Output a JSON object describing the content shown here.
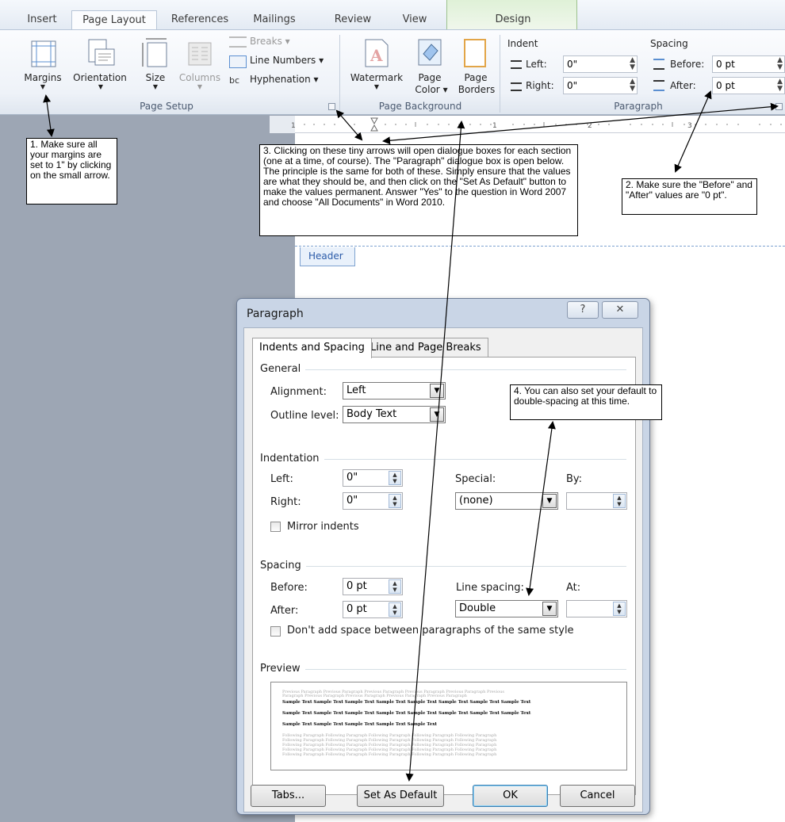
{
  "ribbon_tabs": [
    {
      "label": "Insert"
    },
    {
      "label": "Page Layout"
    },
    {
      "label": "References"
    },
    {
      "label": "Mailings"
    },
    {
      "label": "Review"
    },
    {
      "label": "View"
    },
    {
      "label": "Design"
    }
  ],
  "page_setup": {
    "margins": "Margins",
    "orientation": "Orientation",
    "size": "Size",
    "columns": "Columns",
    "breaks": "Breaks",
    "line_numbers": "Line Numbers",
    "hyphenation": "Hyphenation",
    "group": "Page Setup"
  },
  "page_background": {
    "watermark": "Watermark",
    "page_color_1": "Page",
    "page_color_2": "Color",
    "page_borders_1": "Page",
    "page_borders_2": "Borders",
    "group": "Page Background"
  },
  "paragraph_group": {
    "indent_title": "Indent",
    "left_label": "Left:",
    "left_value": "0\"",
    "right_label": "Right:",
    "right_value": "0\"",
    "spacing_title": "Spacing",
    "before_label": "Before:",
    "before_value": "0 pt",
    "after_label": "After:",
    "after_value": "0 pt",
    "group": "Paragraph"
  },
  "header_tab": "Header",
  "callouts": {
    "c1": "1. Make sure all your margins are set to 1\" by clicking on the small arrow.",
    "c2": "2. Make sure the \"Before\" and \"After\" values are \"0 pt\".",
    "c3": "3. Clicking on these tiny arrows will open dialogue boxes for each section (one at a time, of course). The \"Paragraph\" dialogue box is open below. The principle is the same for both of these. Simply ensure that the values are what they should be, and then click on the \"Set As Default\" button to make the values permanent. Answer \"Yes\" to the question in Word 2007 and choose \"All Documents\" in Word 2010.",
    "c4": "4. You can also set your default to double-spacing at this time."
  },
  "dialog": {
    "title": "Paragraph",
    "help_glyph": "?",
    "close_glyph": "✕",
    "tabs": [
      "Indents and Spacing",
      "Line and Page Breaks"
    ],
    "general": {
      "section": "General",
      "alignment_label": "Alignment:",
      "alignment_value": "Left",
      "outline_label": "Outline level:",
      "outline_value": "Body Text"
    },
    "indentation": {
      "section": "Indentation",
      "left_label": "Left:",
      "left_value": "0\"",
      "right_label": "Right:",
      "right_value": "0\"",
      "special_label": "Special:",
      "special_value": "(none)",
      "by_label": "By:",
      "mirror_label": "Mirror indents"
    },
    "spacing": {
      "section": "Spacing",
      "before_label": "Before:",
      "before_value": "0 pt",
      "after_label": "After:",
      "after_value": "0 pt",
      "line_spacing_label": "Line spacing:",
      "line_spacing_value": "Double",
      "at_label": "At:",
      "dont_add_label": "Don't add space between paragraphs of the same style"
    },
    "preview": {
      "section": "Preview",
      "prev_1": "Previous Paragraph Previous Paragraph Previous Paragraph Previous Paragraph Previous Paragraph Previous",
      "prev_2": "Paragraph Previous Paragraph Previous Paragraph Previous Paragraph Previous Paragraph",
      "sample_1": "Sample Text Sample Text Sample Text Sample Text Sample Text Sample Text Sample Text Sample Text",
      "sample_2": "Sample Text Sample Text Sample Text Sample Text Sample Text Sample Text Sample Text Sample Text",
      "sample_3": "Sample Text Sample Text Sample Text Sample Text Sample Text",
      "follow_1": "Following Paragraph Following Paragraph Following Paragraph Following Paragraph Following Paragraph",
      "follow_2": "Following Paragraph Following Paragraph Following Paragraph Following Paragraph Following Paragraph",
      "follow_3": "Following Paragraph Following Paragraph Following Paragraph Following Paragraph Following Paragraph",
      "follow_4": "Following Paragraph Following Paragraph Following Paragraph Following Paragraph Following Paragraph",
      "follow_5": "Following Paragraph Following Paragraph Following Paragraph Following Paragraph Following Paragraph"
    },
    "buttons": {
      "tabs": "Tabs...",
      "set_default": "Set As Default",
      "ok": "OK",
      "cancel": "Cancel"
    }
  }
}
